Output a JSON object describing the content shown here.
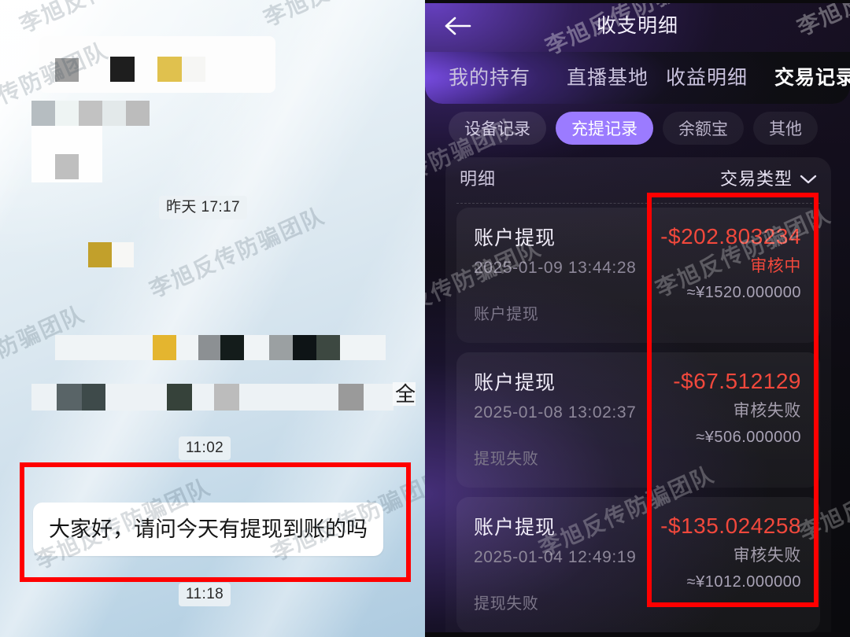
{
  "watermark": {
    "text": "李旭反传防骗团队"
  },
  "left_chat": {
    "name": "chat-screenshot",
    "timestamps": [
      {
        "label": "昨天 17:17"
      },
      {
        "label": "11:02"
      },
      {
        "label": "11:18"
      }
    ],
    "message": {
      "text": "大家好，请问今天有提现到账的吗"
    },
    "partial_glyph": "全"
  },
  "right_app": {
    "header": {
      "back_icon": "back-arrow-icon",
      "title": "收支明细"
    },
    "tabs": [
      {
        "label": "我的持有",
        "active": false
      },
      {
        "label": "直播基地",
        "active": false
      },
      {
        "label": "收益明细",
        "active": false
      },
      {
        "label": "交易记录",
        "active": true
      }
    ],
    "filter_pills": [
      {
        "label": "设备记录",
        "active": false
      },
      {
        "label": "充提记录",
        "active": true
      },
      {
        "label": "余额宝",
        "active": false
      },
      {
        "label": "其他",
        "active": false
      }
    ],
    "panel": {
      "title": "明细",
      "filter_select": {
        "label": "交易类型",
        "icon": "chevron-down-icon"
      }
    },
    "transactions": [
      {
        "name": "账户提现",
        "date": "2025-01-09 13:44:28",
        "note": "账户提现",
        "amount": "-$202.803234",
        "status": "审核中",
        "status_kind": "pending",
        "cny": "≈¥1520.000000"
      },
      {
        "name": "账户提现",
        "date": "2025-01-08 13:02:37",
        "note": "提现失败",
        "amount": "-$67.512129",
        "status": "审核失败",
        "status_kind": "failed",
        "cny": "≈¥506.000000"
      },
      {
        "name": "账户提现",
        "date": "2025-01-04 12:49:19",
        "note": "提现失败",
        "amount": "-$135.024258",
        "status": "审核失败",
        "status_kind": "failed",
        "cny": "≈¥1012.000000"
      }
    ]
  },
  "annotations": {
    "left_box": {
      "name": "red-highlight-box-message"
    },
    "right_box": {
      "name": "red-highlight-box-amounts"
    }
  },
  "colors": {
    "accent_purple": "#9b7bff",
    "amount_red": "#f1483c",
    "annotation_red": "#ff0000",
    "panel_dark": "#0a0a0d",
    "chat_bg": "#cfe0ec"
  }
}
